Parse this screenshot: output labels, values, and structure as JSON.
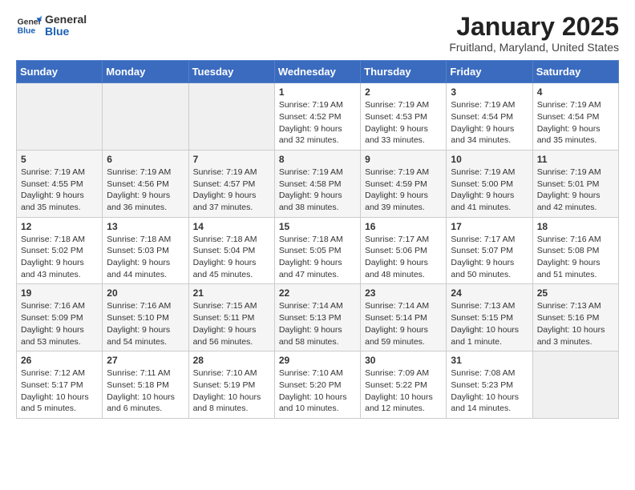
{
  "header": {
    "logo_general": "General",
    "logo_blue": "Blue",
    "title": "January 2025",
    "subtitle": "Fruitland, Maryland, United States"
  },
  "days_of_week": [
    "Sunday",
    "Monday",
    "Tuesday",
    "Wednesday",
    "Thursday",
    "Friday",
    "Saturday"
  ],
  "weeks": [
    [
      {
        "day": "",
        "info": ""
      },
      {
        "day": "",
        "info": ""
      },
      {
        "day": "",
        "info": ""
      },
      {
        "day": "1",
        "info": "Sunrise: 7:19 AM\nSunset: 4:52 PM\nDaylight: 9 hours and 32 minutes."
      },
      {
        "day": "2",
        "info": "Sunrise: 7:19 AM\nSunset: 4:53 PM\nDaylight: 9 hours and 33 minutes."
      },
      {
        "day": "3",
        "info": "Sunrise: 7:19 AM\nSunset: 4:54 PM\nDaylight: 9 hours and 34 minutes."
      },
      {
        "day": "4",
        "info": "Sunrise: 7:19 AM\nSunset: 4:54 PM\nDaylight: 9 hours and 35 minutes."
      }
    ],
    [
      {
        "day": "5",
        "info": "Sunrise: 7:19 AM\nSunset: 4:55 PM\nDaylight: 9 hours and 35 minutes."
      },
      {
        "day": "6",
        "info": "Sunrise: 7:19 AM\nSunset: 4:56 PM\nDaylight: 9 hours and 36 minutes."
      },
      {
        "day": "7",
        "info": "Sunrise: 7:19 AM\nSunset: 4:57 PM\nDaylight: 9 hours and 37 minutes."
      },
      {
        "day": "8",
        "info": "Sunrise: 7:19 AM\nSunset: 4:58 PM\nDaylight: 9 hours and 38 minutes."
      },
      {
        "day": "9",
        "info": "Sunrise: 7:19 AM\nSunset: 4:59 PM\nDaylight: 9 hours and 39 minutes."
      },
      {
        "day": "10",
        "info": "Sunrise: 7:19 AM\nSunset: 5:00 PM\nDaylight: 9 hours and 41 minutes."
      },
      {
        "day": "11",
        "info": "Sunrise: 7:19 AM\nSunset: 5:01 PM\nDaylight: 9 hours and 42 minutes."
      }
    ],
    [
      {
        "day": "12",
        "info": "Sunrise: 7:18 AM\nSunset: 5:02 PM\nDaylight: 9 hours and 43 minutes."
      },
      {
        "day": "13",
        "info": "Sunrise: 7:18 AM\nSunset: 5:03 PM\nDaylight: 9 hours and 44 minutes."
      },
      {
        "day": "14",
        "info": "Sunrise: 7:18 AM\nSunset: 5:04 PM\nDaylight: 9 hours and 45 minutes."
      },
      {
        "day": "15",
        "info": "Sunrise: 7:18 AM\nSunset: 5:05 PM\nDaylight: 9 hours and 47 minutes."
      },
      {
        "day": "16",
        "info": "Sunrise: 7:17 AM\nSunset: 5:06 PM\nDaylight: 9 hours and 48 minutes."
      },
      {
        "day": "17",
        "info": "Sunrise: 7:17 AM\nSunset: 5:07 PM\nDaylight: 9 hours and 50 minutes."
      },
      {
        "day": "18",
        "info": "Sunrise: 7:16 AM\nSunset: 5:08 PM\nDaylight: 9 hours and 51 minutes."
      }
    ],
    [
      {
        "day": "19",
        "info": "Sunrise: 7:16 AM\nSunset: 5:09 PM\nDaylight: 9 hours and 53 minutes."
      },
      {
        "day": "20",
        "info": "Sunrise: 7:16 AM\nSunset: 5:10 PM\nDaylight: 9 hours and 54 minutes."
      },
      {
        "day": "21",
        "info": "Sunrise: 7:15 AM\nSunset: 5:11 PM\nDaylight: 9 hours and 56 minutes."
      },
      {
        "day": "22",
        "info": "Sunrise: 7:14 AM\nSunset: 5:13 PM\nDaylight: 9 hours and 58 minutes."
      },
      {
        "day": "23",
        "info": "Sunrise: 7:14 AM\nSunset: 5:14 PM\nDaylight: 9 hours and 59 minutes."
      },
      {
        "day": "24",
        "info": "Sunrise: 7:13 AM\nSunset: 5:15 PM\nDaylight: 10 hours and 1 minute."
      },
      {
        "day": "25",
        "info": "Sunrise: 7:13 AM\nSunset: 5:16 PM\nDaylight: 10 hours and 3 minutes."
      }
    ],
    [
      {
        "day": "26",
        "info": "Sunrise: 7:12 AM\nSunset: 5:17 PM\nDaylight: 10 hours and 5 minutes."
      },
      {
        "day": "27",
        "info": "Sunrise: 7:11 AM\nSunset: 5:18 PM\nDaylight: 10 hours and 6 minutes."
      },
      {
        "day": "28",
        "info": "Sunrise: 7:10 AM\nSunset: 5:19 PM\nDaylight: 10 hours and 8 minutes."
      },
      {
        "day": "29",
        "info": "Sunrise: 7:10 AM\nSunset: 5:20 PM\nDaylight: 10 hours and 10 minutes."
      },
      {
        "day": "30",
        "info": "Sunrise: 7:09 AM\nSunset: 5:22 PM\nDaylight: 10 hours and 12 minutes."
      },
      {
        "day": "31",
        "info": "Sunrise: 7:08 AM\nSunset: 5:23 PM\nDaylight: 10 hours and 14 minutes."
      },
      {
        "day": "",
        "info": ""
      }
    ]
  ]
}
